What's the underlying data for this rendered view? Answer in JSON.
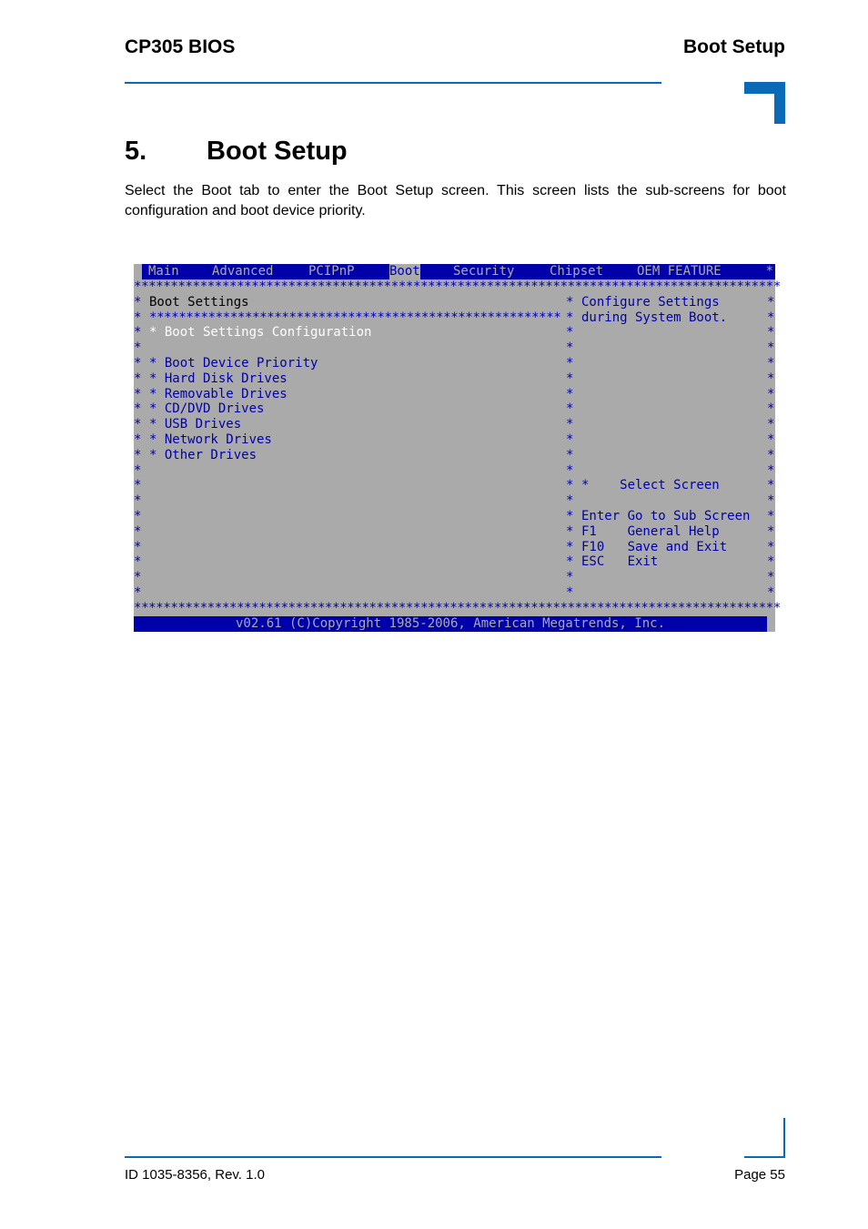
{
  "header": {
    "left": "CP305 BIOS",
    "right": "Boot Setup"
  },
  "section": {
    "number": "5.",
    "title": "Boot Setup",
    "intro": "Select the Boot tab to enter the Boot Setup screen. This screen lists the sub-screens for boot configuration and boot device priority."
  },
  "bios": {
    "tabs": [
      {
        "label": "Main",
        "active": false
      },
      {
        "label": "Advanced",
        "active": false
      },
      {
        "label": "PCIPnP",
        "active": false
      },
      {
        "label": "Boot",
        "active": true
      },
      {
        "label": "Security",
        "active": false
      },
      {
        "label": "Chipset",
        "active": false
      },
      {
        "label": "OEM FEATURE",
        "active": false
      }
    ],
    "border_char": "*",
    "panel_title": "Boot Settings",
    "selected_item": "Boot Settings Configuration",
    "items": [
      "Boot Device Priority",
      "Hard Disk Drives",
      "Removable Drives",
      "CD/DVD Drives",
      "USB Drives",
      "Network Drives",
      "Other Drives"
    ],
    "help_text": [
      "Configure Settings",
      "during System Boot."
    ],
    "keys": [
      {
        "key": "*",
        "action": "Select Screen"
      },
      {
        "key": "Enter",
        "action": "Go to Sub Screen"
      },
      {
        "key": "F1",
        "action": "General Help"
      },
      {
        "key": "F10",
        "action": "Save and Exit"
      },
      {
        "key": "ESC",
        "action": "Exit"
      }
    ],
    "footer": "v02.61 (C)Copyright 1985-2006, American Megatrends, Inc.",
    "colors": {
      "blue": "#0000aa",
      "gray": "#aaaaaa",
      "white": "#ffffff"
    }
  },
  "footer": {
    "left": "ID 1035-8356, Rev. 1.0",
    "right": "Page 55"
  },
  "accent_color": "#0a6ab5"
}
